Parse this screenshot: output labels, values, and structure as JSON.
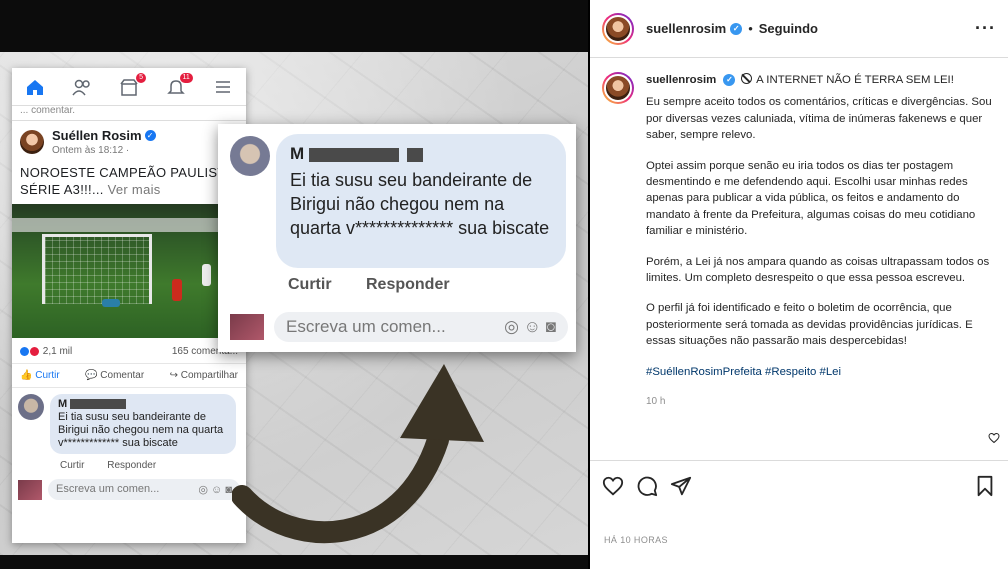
{
  "facebook_screenshot": {
    "prev_comment": "... comentar.",
    "author": "Suéllen Rosim",
    "timestamp": "Ontem às 18:12 ·",
    "post_text": "NOROESTE CAMPEÃO PAULISTA SÉRIE A3!!!...",
    "see_more": "Ver mais",
    "reactions_count": "2,1 mil",
    "comments_count": "165 comentá...",
    "like_label": "Curtir",
    "comment_label": "Comentar",
    "share_label": "Compartilhar",
    "comment_author_initial": "M",
    "comment_text": "Ei tia susu seu bandeirante de Birigui não chegou nem na quarta v************* sua biscate",
    "comment_actions": "Curtir Responder",
    "write_placeholder": "Escreva um comen...",
    "nav_badges": [
      "5",
      "11"
    ]
  },
  "zoomed_comment": {
    "author_initial": "M",
    "text": "Ei tia susu seu bandeirante de Birigui não chegou nem na quarta v************** sua biscate",
    "actions": "Curtir Responder",
    "write_placeholder": "Escreva um comen..."
  },
  "instagram": {
    "username": "suellenrosim",
    "follow_status": "Seguindo",
    "more": "···",
    "caption_title": "A INTERNET NÃO É TERRA SEM LEI!",
    "paragraphs": [
      "Eu sempre aceito todos os comentários, críticas e divergências. Sou por diversas vezes caluniada, vítima de inúmeras fakenews e quer saber, sempre relevo.",
      "Optei assim porque senão eu iria todos os dias ter postagem desmentindo e me defendendo aqui. Escolhi usar minhas redes apenas para publicar a vida pública, os feitos e andamento do mandato à frente da Prefeitura, algumas coisas do meu cotidiano familiar e ministério.",
      "Porém, a Lei já nos ampara quando as coisas ultrapassam todos os limites. Um completo desrespeito o que essa pessoa escreveu.",
      "O perfil já foi identificado e feito o boletim de ocorrência, que posteriormente será tomada as devidas providências jurídicas. E essas situações não passarão mais despercebidas!"
    ],
    "hashtags": "#SuéllenRosimPrefeita #Respeito #Lei",
    "caption_time": "10 h",
    "post_date": "HÁ 10 HORAS",
    "icons": [
      "heart-icon",
      "comment-icon",
      "share-icon",
      "bookmark-icon"
    ]
  }
}
